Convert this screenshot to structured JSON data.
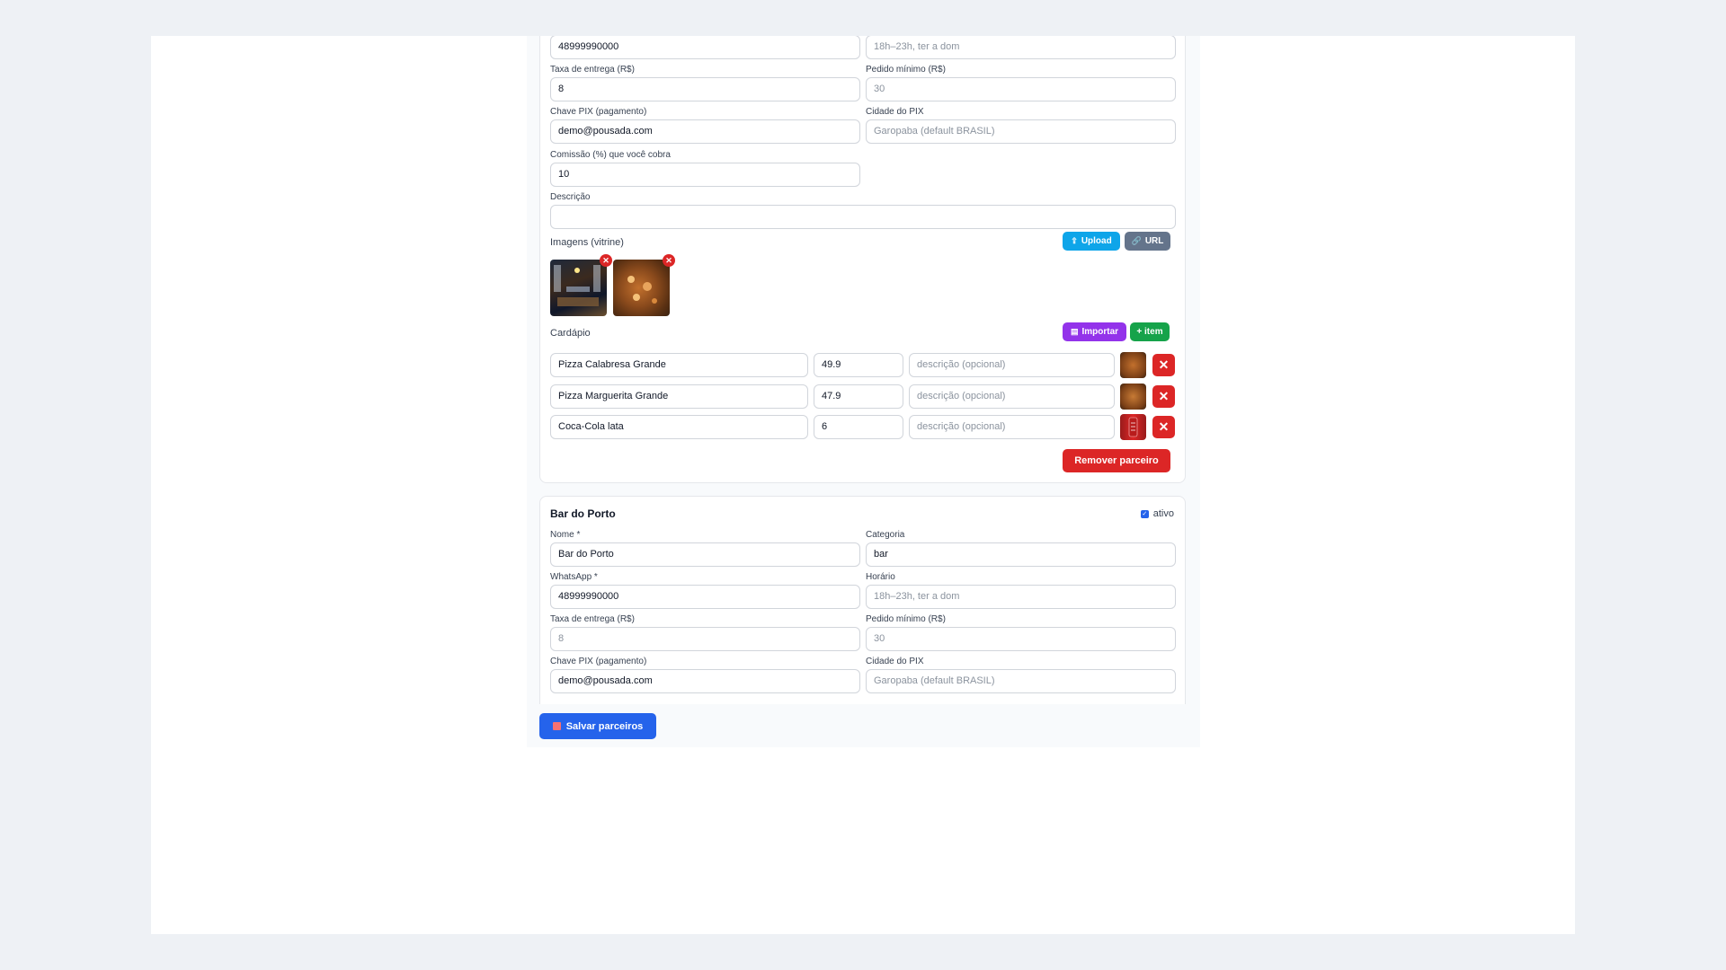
{
  "partner1": {
    "whatsapp_value": "48999990000",
    "horario_placeholder": "18h–23h, ter a dom",
    "taxa_label": "Taxa de entrega (R$)",
    "taxa_value": "8",
    "pedido_label": "Pedido mínimo (R$)",
    "pedido_placeholder": "30",
    "pix_label": "Chave PIX (pagamento)",
    "pix_value": "demo@pousada.com",
    "cidade_label": "Cidade do PIX",
    "cidade_placeholder": "Garopaba (default BRASIL)",
    "comissao_label": "Comissão (%) que você cobra",
    "comissao_value": "10",
    "descricao_label": "Descrição",
    "descricao_value": "",
    "imagens_label": "Imagens (vitrine)",
    "upload_label": "Upload",
    "url_label": "URL",
    "cardapio_label": "Cardápio",
    "importar_label": "Importar",
    "add_item_label": "+ item",
    "menu": [
      {
        "name": "Pizza Calabresa Grande",
        "price": "49.9",
        "desc_placeholder": "descrição (opcional)"
      },
      {
        "name": "Pizza Marguerita Grande",
        "price": "47.9",
        "desc_placeholder": "descrição (opcional)"
      },
      {
        "name": "Coca-Cola lata",
        "price": "6",
        "desc_placeholder": "descrição (opcional)"
      }
    ],
    "remove_label": "Remover parceiro"
  },
  "partner2": {
    "title": "Bar do Porto",
    "ativo_label": "ativo",
    "ativo_checked": true,
    "nome_label": "Nome *",
    "nome_value": "Bar do Porto",
    "categoria_label": "Categoria",
    "categoria_value": "bar",
    "whatsapp_label": "WhatsApp *",
    "whatsapp_value": "48999990000",
    "horario_label": "Horário",
    "horario_placeholder": "18h–23h, ter a dom",
    "taxa_label": "Taxa de entrega (R$)",
    "taxa_placeholder": "8",
    "pedido_label": "Pedido mínimo (R$)",
    "pedido_placeholder": "30",
    "pix_label": "Chave PIX (pagamento)",
    "pix_value": "demo@pousada.com",
    "cidade_label": "Cidade do PIX",
    "cidade_placeholder": "Garopaba (default BRASIL)"
  },
  "save_label": "Salvar parceiros",
  "colors": {
    "upload": "#0ea5e9",
    "url": "#64748b",
    "importar": "#9333ea",
    "add_item": "#16a34a",
    "danger": "#dc2626",
    "save": "#2563eb"
  }
}
